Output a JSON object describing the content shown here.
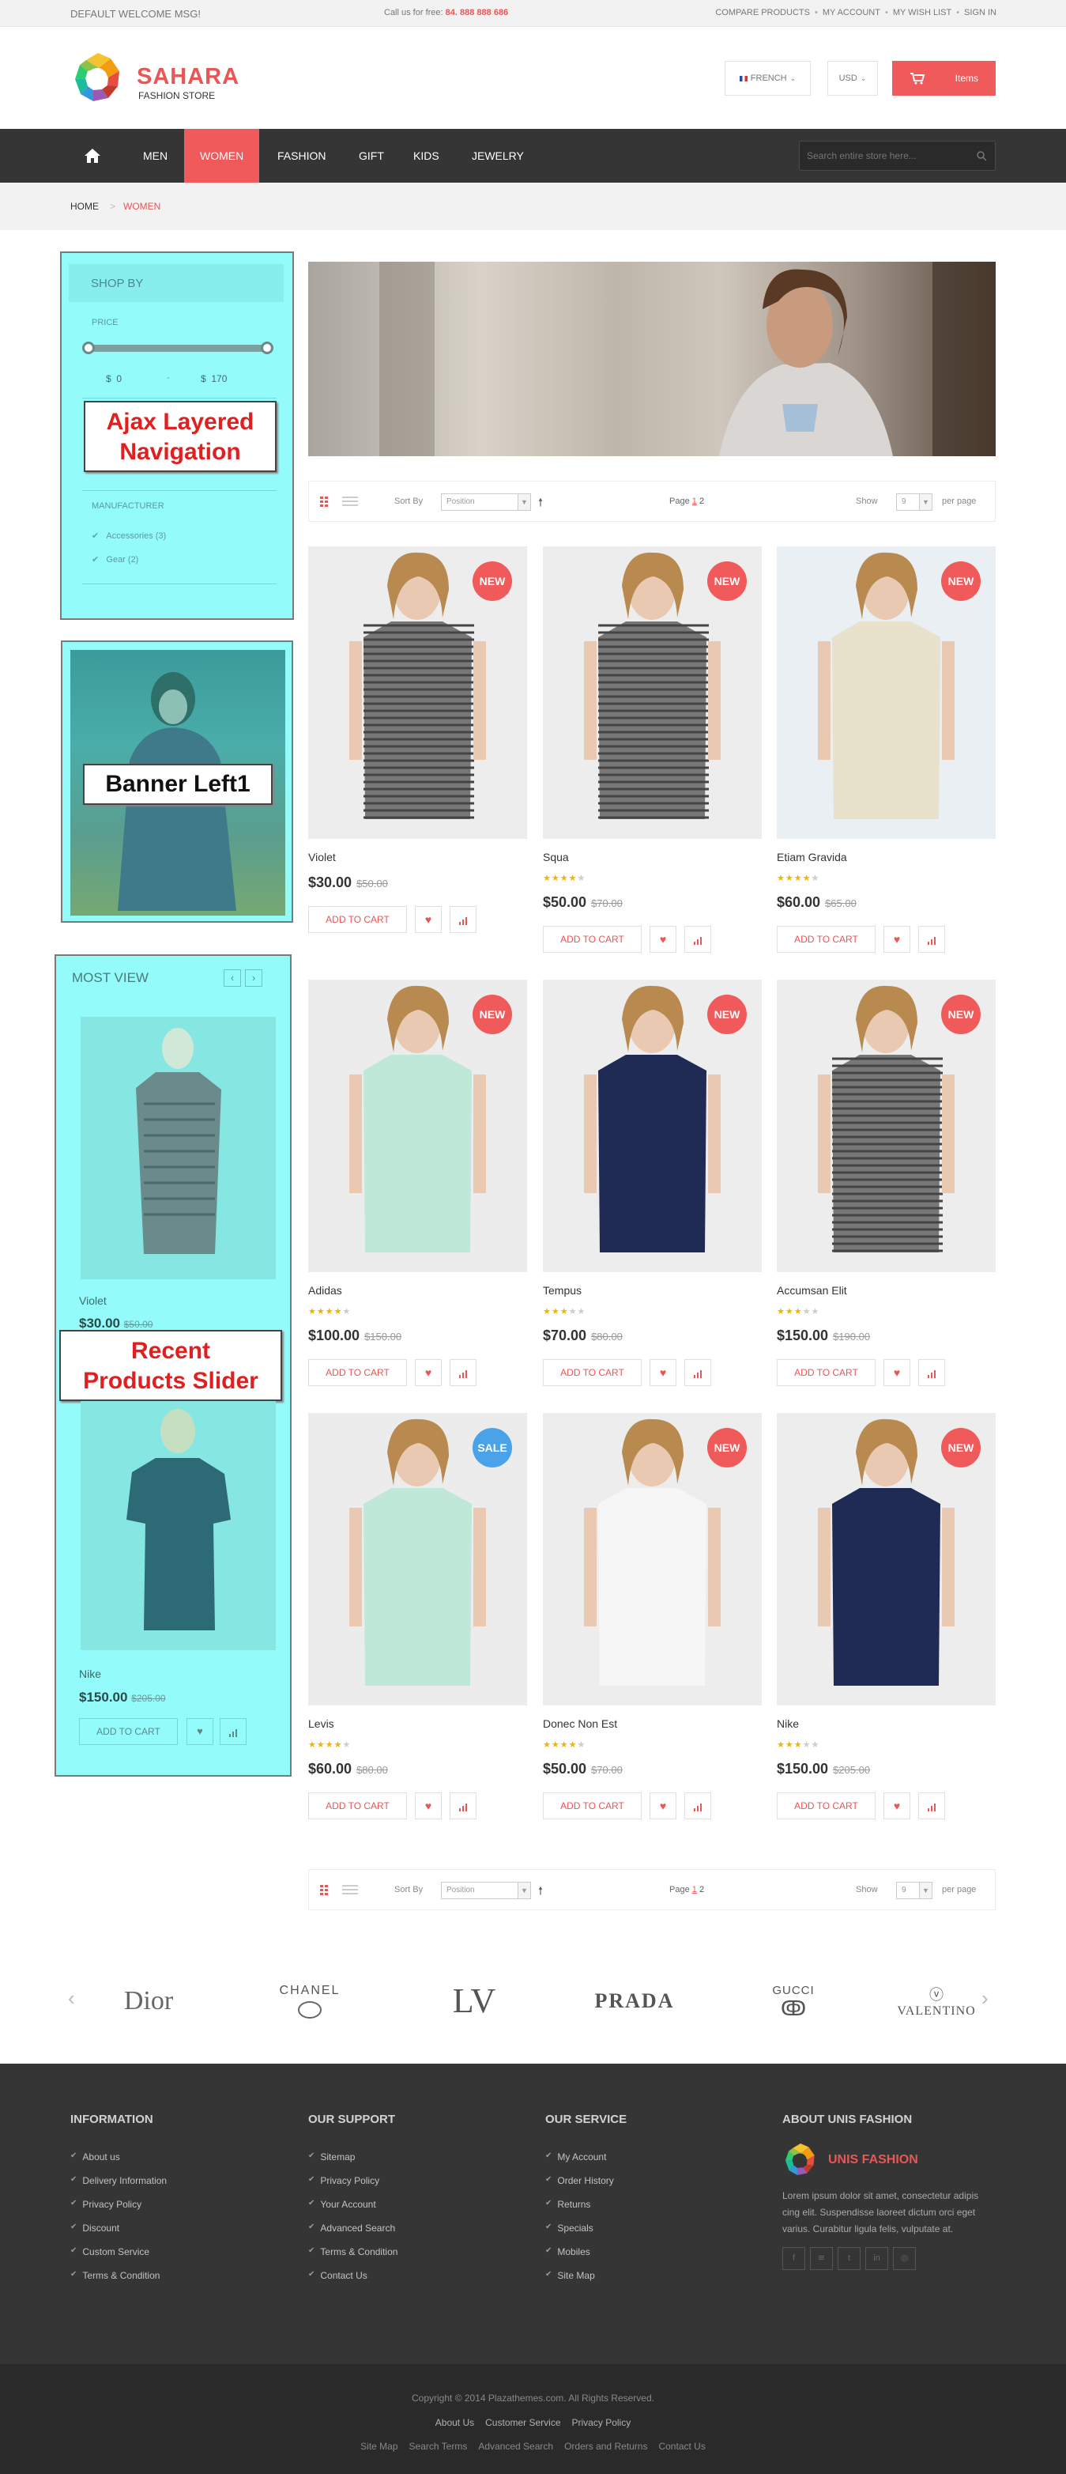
{
  "topbar": {
    "welcome": "DEFAULT WELCOME MSG!",
    "call_label": "Call us for free:",
    "phone": "84. 888 888 686",
    "links": [
      "COMPARE PRODUCTS",
      "MY ACCOUNT",
      "MY WISH LIST",
      "SIGN IN"
    ]
  },
  "header": {
    "logo_name": "SAHARA",
    "logo_tagline": "FASHION STORE",
    "language": "FRENCH",
    "currency": "USD",
    "cart_label": "Items"
  },
  "nav": {
    "items": [
      "MEN",
      "WOMEN",
      "FASHION",
      "GIFT",
      "KIDS",
      "JEWELRY"
    ],
    "search_placeholder": "Search entire store here..."
  },
  "breadcrumb": {
    "home": "HOME",
    "current": "WOMEN"
  },
  "sidebar": {
    "shop_by": "SHOP BY",
    "price_label": "PRICE",
    "price_min": "$",
    "price_min_value": "0",
    "price_dash": "-",
    "price_max": "$",
    "price_max_value": "170",
    "manufacturer_label": "MANUFACTURER",
    "manufacturers": [
      "Accessories (3)",
      "Gear (2)"
    ],
    "ajax_label_1": "Ajax Layered",
    "ajax_label_2": "Navigation",
    "banner_label": "Banner Left1",
    "most_view_title": "MOST VIEW",
    "recent_label_1": "Recent",
    "recent_label_2": "Products Slider",
    "mv_items": [
      {
        "name": "Violet",
        "price": "$30.00",
        "old_price": "$50.00"
      },
      {
        "name": "Nike",
        "price": "$150.00",
        "old_price": "$205.00"
      }
    ],
    "mv_add_to_cart": "ADD TO CART"
  },
  "toolbar": {
    "sort_by": "Sort By",
    "sort_value": "Position",
    "page_label": "Page",
    "pages": [
      "1",
      "2"
    ],
    "show_label": "Show",
    "show_value": "9",
    "per_page": "per page"
  },
  "products": [
    {
      "name": "Violet",
      "price": "$30.00",
      "old_price": "$50.00",
      "badge": "NEW",
      "stars": 0
    },
    {
      "name": "Squa",
      "price": "$50.00",
      "old_price": "$70.00",
      "badge": "NEW",
      "stars": 4
    },
    {
      "name": "Etiam Gravida",
      "price": "$60.00",
      "old_price": "$65.00",
      "badge": "NEW",
      "stars": 4
    },
    {
      "name": "Adidas",
      "price": "$100.00",
      "old_price": "$150.00",
      "badge": "NEW",
      "stars": 4
    },
    {
      "name": "Tempus",
      "price": "$70.00",
      "old_price": "$80.00",
      "badge": "NEW",
      "stars": 3
    },
    {
      "name": "Accumsan Elit",
      "price": "$150.00",
      "old_price": "$190.00",
      "badge": "NEW",
      "stars": 3
    },
    {
      "name": "Levis",
      "price": "$60.00",
      "old_price": "$80.00",
      "badge": "SALE",
      "stars": 4
    },
    {
      "name": "Donec Non Est",
      "price": "$50.00",
      "old_price": "$70.00",
      "badge": "NEW",
      "stars": 4
    },
    {
      "name": "Nike",
      "price": "$150.00",
      "old_price": "$205.00",
      "badge": "NEW",
      "stars": 3
    }
  ],
  "add_to_cart": "ADD TO CART",
  "brands": [
    "Dior",
    "CHANEL",
    "LV",
    "PRADA",
    "GUCCI",
    "VALENTINO"
  ],
  "footer": {
    "information": {
      "title": "INFORMATION",
      "links": [
        "About us",
        "Delivery Information",
        "Privacy Policy",
        "Discount",
        "Custom Service",
        "Terms & Condition"
      ]
    },
    "support": {
      "title": "OUR SUPPORT",
      "links": [
        "Sitemap",
        "Privacy Policy",
        "Your Account",
        "Advanced Search",
        "Terms & Condition",
        "Contact Us"
      ]
    },
    "service": {
      "title": "OUR SERVICE",
      "links": [
        "My Account",
        "Order History",
        "Returns",
        "Specials",
        "Mobiles",
        "Site Map"
      ]
    },
    "about": {
      "title": "ABOUT UNIS FASHION",
      "brand": "UNIS FASHION",
      "text": "Lorem ipsum dolor sit amet, consectetur adipis cing elit. Suspendisse laoreet dictum orci eget varius. Curabitur ligula felis, vulputate at."
    }
  },
  "bottom": {
    "copyright": "Copyright © 2014 Plazathemes.com. All Rights Reserved.",
    "links1": [
      "About Us",
      "Customer Service",
      "Privacy Policy"
    ],
    "links2": [
      "Site Map",
      "Search Terms",
      "Advanced Search",
      "Orders and Returns",
      "Contact Us"
    ]
  },
  "colors": {
    "accent": "#f15a5a",
    "dark": "#353535",
    "cyan_overlay": "#94fbfb",
    "sale_badge": "#4aa3e8"
  }
}
